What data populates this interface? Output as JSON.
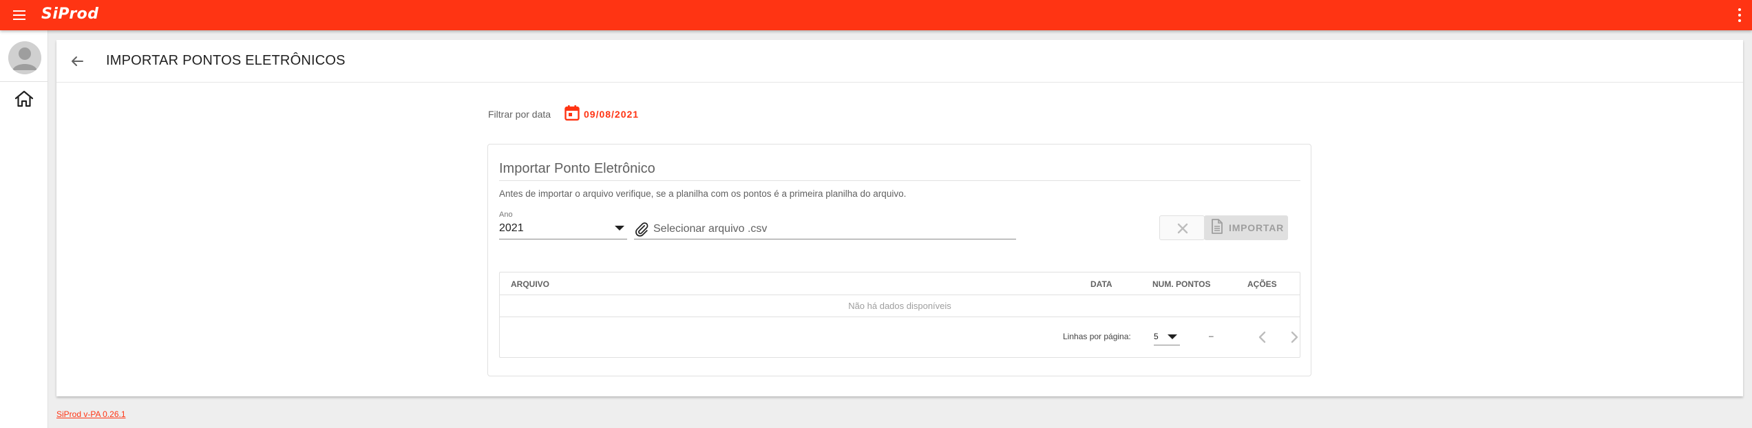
{
  "app": {
    "logo": "SiProd",
    "menu_icon": "menu-icon",
    "more_icon": "more-vert-icon"
  },
  "sidebar": {
    "avatar_icon": "user-avatar-icon",
    "items": [
      {
        "icon": "home-icon"
      }
    ]
  },
  "header": {
    "back_icon": "arrow-back-icon",
    "title": "IMPORTAR PONTOS ELETRÔNICOS"
  },
  "filter": {
    "label": "Filtrar por data",
    "date_icon": "calendar-icon",
    "date": "09/08/2021"
  },
  "import_panel": {
    "title": "Importar Ponto Eletrônico",
    "note": "Antes de importar o arquivo verifique, se a planilha com os pontos é a primeira planilha do arquivo.",
    "year_field": {
      "label": "Ano",
      "value": "2021"
    },
    "file_field": {
      "placeholder": "Selecionar arquivo .csv",
      "icon": "paperclip-icon"
    },
    "clear_icon": "close-icon",
    "import_button": {
      "label": "IMPORTAR",
      "icon": "file-icon"
    }
  },
  "table": {
    "columns": [
      "ARQUIVO",
      "DATA",
      "NUM. PONTOS",
      "AÇÕES"
    ],
    "empty_text": "Não há dados disponíveis",
    "rows_per_page_label": "Linhas por página:",
    "rows_per_page": "5",
    "range": "–"
  },
  "footer": {
    "version": "SiProd v-PA 0.26.1"
  },
  "colors": {
    "accent": "#ff3413",
    "background": "#eeeeee",
    "disabled": "#e0e0e0"
  }
}
